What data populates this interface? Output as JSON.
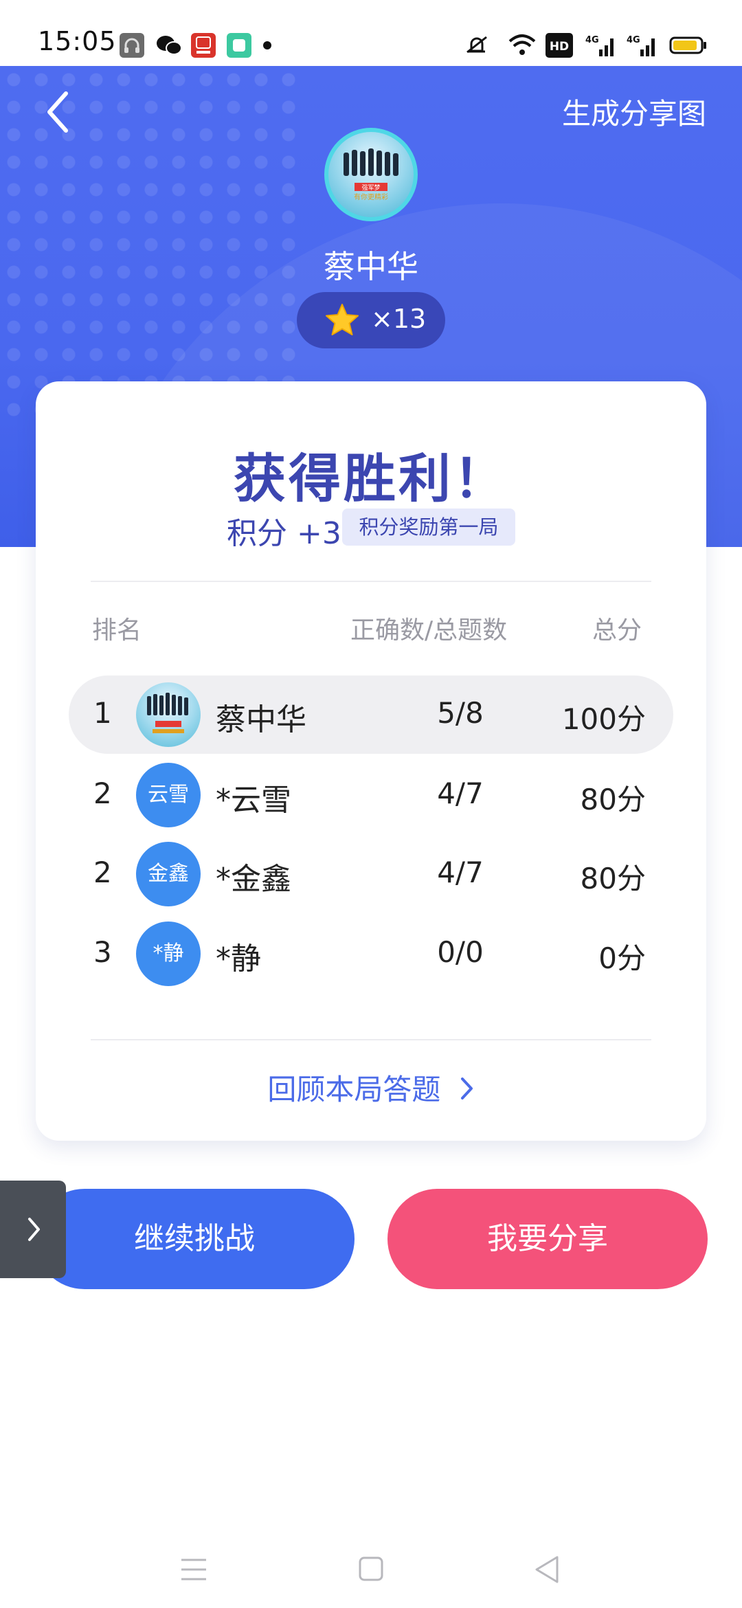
{
  "status_bar": {
    "time": "15:05",
    "icons_left": [
      "headphones-icon",
      "wechat-icon",
      "app-icon-red",
      "app-icon-green"
    ],
    "icons_right": [
      "mute-icon",
      "wifi-icon",
      "hd-icon",
      "4g-signal-icon",
      "4g-signal-icon",
      "battery-icon"
    ],
    "hd_label": "HD",
    "net_label_1": "4G",
    "net_label_2": "4G",
    "battery_level": 0.75
  },
  "header": {
    "back_icon": "back-chevron-icon",
    "share_image_label": "生成分享图",
    "user_name": "蔡中华",
    "star_icon": "star-icon",
    "star_count": "×13",
    "avatar_caption_1": "强军梦",
    "avatar_caption_2": "有你更精彩"
  },
  "result": {
    "title": "获得胜利！",
    "points": "积分 +3",
    "points_badge": "积分奖励第一局"
  },
  "table": {
    "headers": {
      "rank": "排名",
      "correct": "正确数/总题数",
      "score": "总分"
    },
    "rows": [
      {
        "rank": "1",
        "avatar": "photo",
        "name": "蔡中华",
        "correct": "5/8",
        "score": "100分",
        "highlight": true
      },
      {
        "rank": "2",
        "avatar": "云雪",
        "name": "*云雪",
        "correct": "4/7",
        "score": "80分",
        "highlight": false
      },
      {
        "rank": "2",
        "avatar": "金鑫",
        "name": "*金鑫",
        "correct": "4/7",
        "score": "80分",
        "highlight": false
      },
      {
        "rank": "3",
        "avatar": "*静",
        "name": "*静",
        "correct": "0/0",
        "score": "0分",
        "highlight": false
      }
    ]
  },
  "review_link": "回顾本局答题",
  "buttons": {
    "continue": "继续挑战",
    "share": "我要分享"
  },
  "nav": {
    "icons": [
      "menu-icon",
      "home-icon",
      "back-triangle-icon"
    ]
  },
  "colors": {
    "primary": "#3f6cf0",
    "accent_pink": "#f4527a",
    "title_indigo": "#3c46b0"
  }
}
